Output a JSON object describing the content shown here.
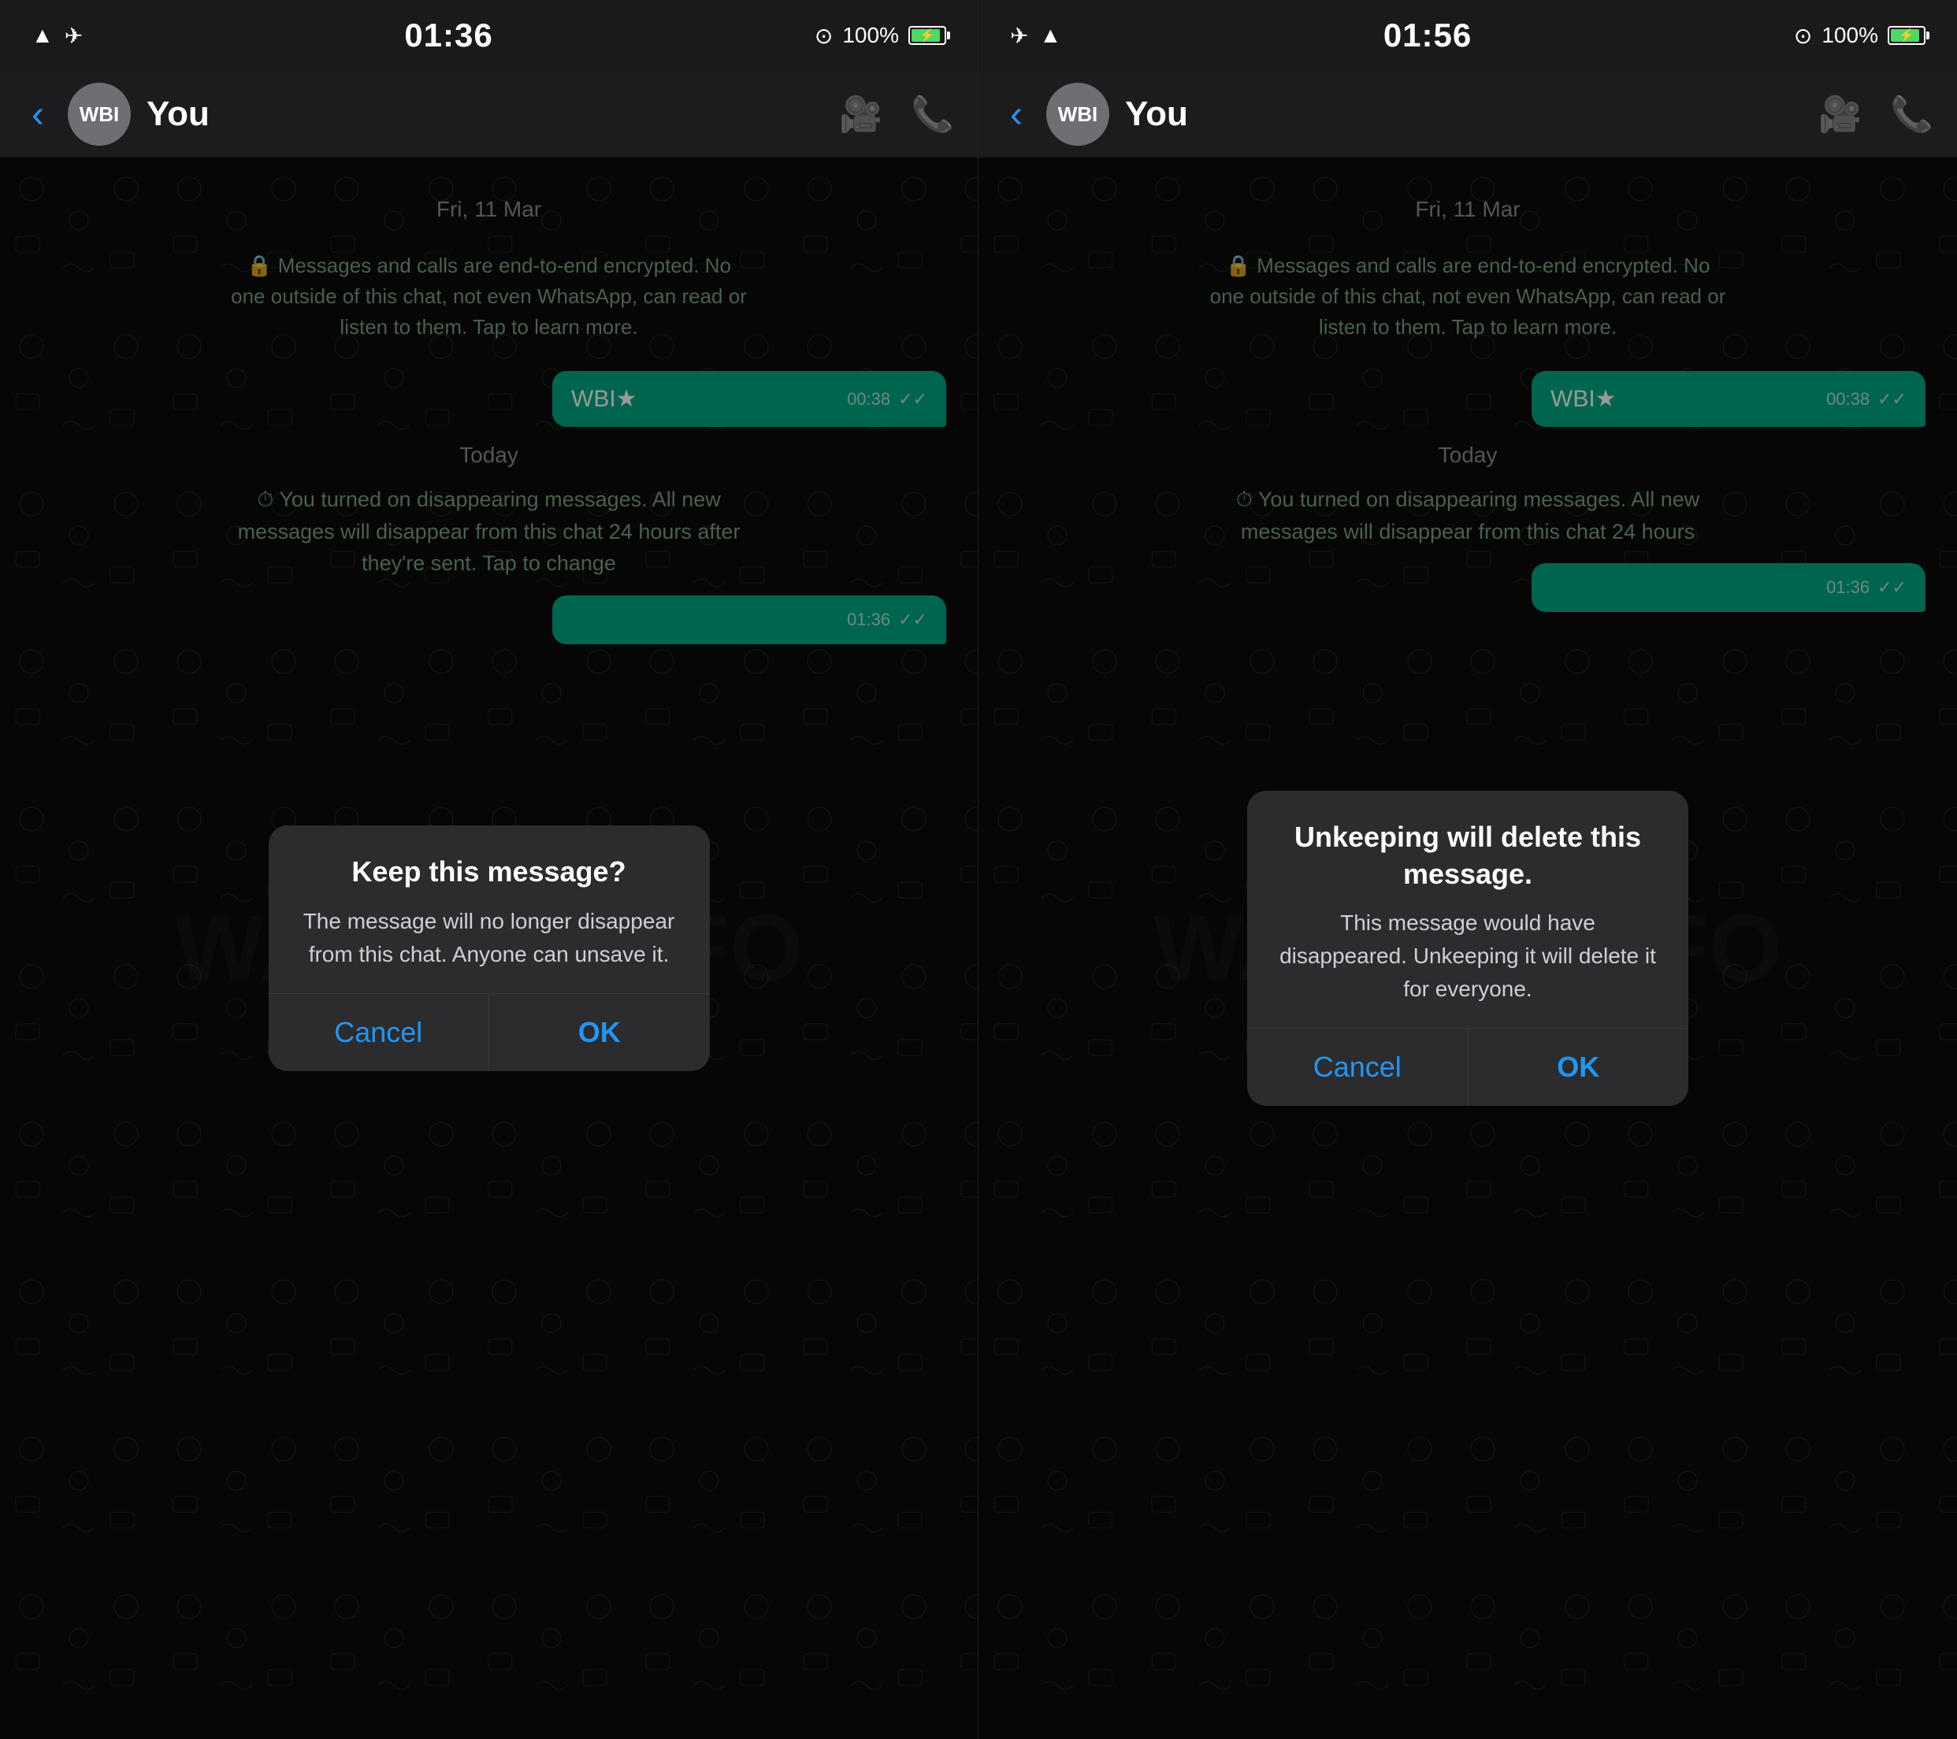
{
  "left_screen": {
    "status_bar": {
      "time": "01:36",
      "battery_pct": "100%",
      "battery_charging": true
    },
    "nav": {
      "contact_name": "You",
      "avatar_initials": "WBI",
      "video_icon": "📹",
      "call_icon": "📞"
    },
    "chat": {
      "date1": "Fri, 11 Mar",
      "encryption_notice": "🔒 Messages and calls are end-to-end encrypted. No one outside of this chat, not even WhatsApp, can read or listen to them. Tap to learn more.",
      "message_text": "WBI★",
      "message_time": "00:38",
      "date2": "Today",
      "disappearing_notice": "⏱ You turned on disappearing messages. All new messages will disappear from this chat 24 hours after they're sent. Tap to change",
      "message2_time": "01:36"
    },
    "dialog": {
      "title": "Keep this message?",
      "message": "The message will no longer disappear from this chat. Anyone can unsave it.",
      "cancel_label": "Cancel",
      "ok_label": "OK"
    }
  },
  "right_screen": {
    "status_bar": {
      "time": "01:56",
      "battery_pct": "100%",
      "battery_charging": true
    },
    "nav": {
      "contact_name": "You",
      "avatar_initials": "WBI",
      "video_icon": "📹",
      "call_icon": "📞"
    },
    "chat": {
      "date1": "Fri, 11 Mar",
      "encryption_notice": "🔒 Messages and calls are end-to-end encrypted. No one outside of this chat, not even WhatsApp, can read or listen to them. Tap to learn more.",
      "message_text": "WBI★",
      "message_time": "00:38",
      "date2": "Today",
      "disappearing_notice": "⏱ You turned on disappearing messages. All new messages will disappear from this chat 24 hours",
      "message2_time": "01:36"
    },
    "dialog": {
      "title": "Unkeeping will delete this message.",
      "message": "This message would have disappeared. Unkeeping it will delete it for everyone.",
      "cancel_label": "Cancel",
      "ok_label": "OK"
    }
  },
  "watermark": "WABETAINFO"
}
